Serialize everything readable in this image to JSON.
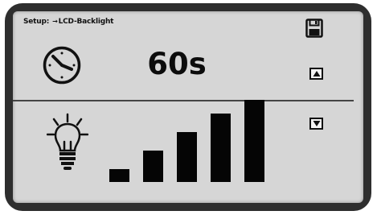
{
  "header": {
    "prefix": "Setup:",
    "arrow": "→",
    "title": "LCD-Backlight"
  },
  "setting": {
    "value": "60s"
  },
  "icons": {
    "save": "save-disk-icon",
    "clock": "clock-icon",
    "bulb": "light-bulb-icon",
    "up": "up-arrow-icon",
    "down": "down-arrow-icon"
  },
  "brightness": {
    "levels_total": 5,
    "levels_shown": 5
  },
  "colors": {
    "screen": "#d6d6d6",
    "bezel": "#2e2e2e",
    "ink": "#0c0c0c"
  }
}
